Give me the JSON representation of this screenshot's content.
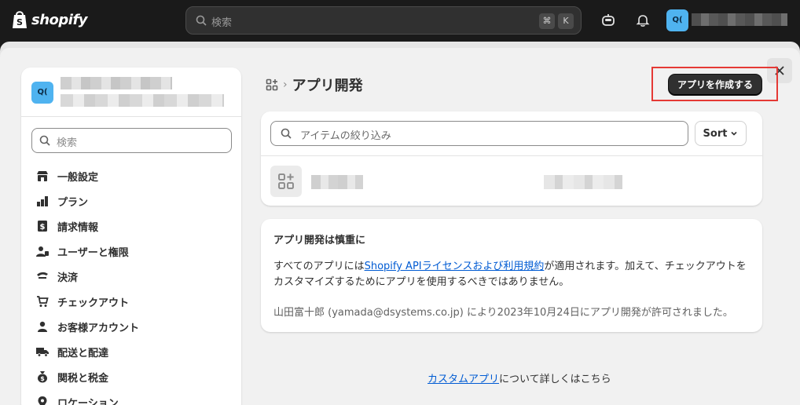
{
  "topbar": {
    "brand": "shopify",
    "search_placeholder": "検索",
    "shortcut_cmd": "⌘",
    "shortcut_key": "K",
    "store_initials": "Q("
  },
  "sidebar": {
    "store_initials": "Q(",
    "search_placeholder": "検索",
    "items": [
      {
        "label": "一般設定",
        "icon": "store-icon"
      },
      {
        "label": "プラン",
        "icon": "plan-icon"
      },
      {
        "label": "請求情報",
        "icon": "billing-icon"
      },
      {
        "label": "ユーザーと権限",
        "icon": "users-icon"
      },
      {
        "label": "決済",
        "icon": "payments-icon"
      },
      {
        "label": "チェックアウト",
        "icon": "cart-icon"
      },
      {
        "label": "お客様アカウント",
        "icon": "person-icon"
      },
      {
        "label": "配送と配達",
        "icon": "truck-icon"
      },
      {
        "label": "関税と税金",
        "icon": "tax-icon"
      },
      {
        "label": "ロケーション",
        "icon": "location-icon"
      }
    ]
  },
  "header": {
    "breadcrumb_sep": "›",
    "title": "アプリ開発",
    "create_button": "アプリを作成する"
  },
  "filter": {
    "placeholder": "アイテムの絞り込み",
    "sort_label": "Sort"
  },
  "notice": {
    "title": "アプリ開発は慎重に",
    "body_prefix": "すべてのアプリには",
    "link_text": "Shopify APIライセンスおよび利用規約",
    "body_suffix": "が適用されます。加えて、チェックアウトをカスタマイズするためにアプリを使用するべきではありません。",
    "footer": "山田富十郎 (yamada@dsystems.co.jp) により2023年10月24日にアプリ開発が許可されました。"
  },
  "bottom": {
    "link_text": "カスタムアプリ",
    "suffix": "について詳しくはこちら"
  },
  "colors": {
    "accent_link": "#005bd3",
    "highlight": "#e53935",
    "avatar": "#4fb3f0"
  }
}
